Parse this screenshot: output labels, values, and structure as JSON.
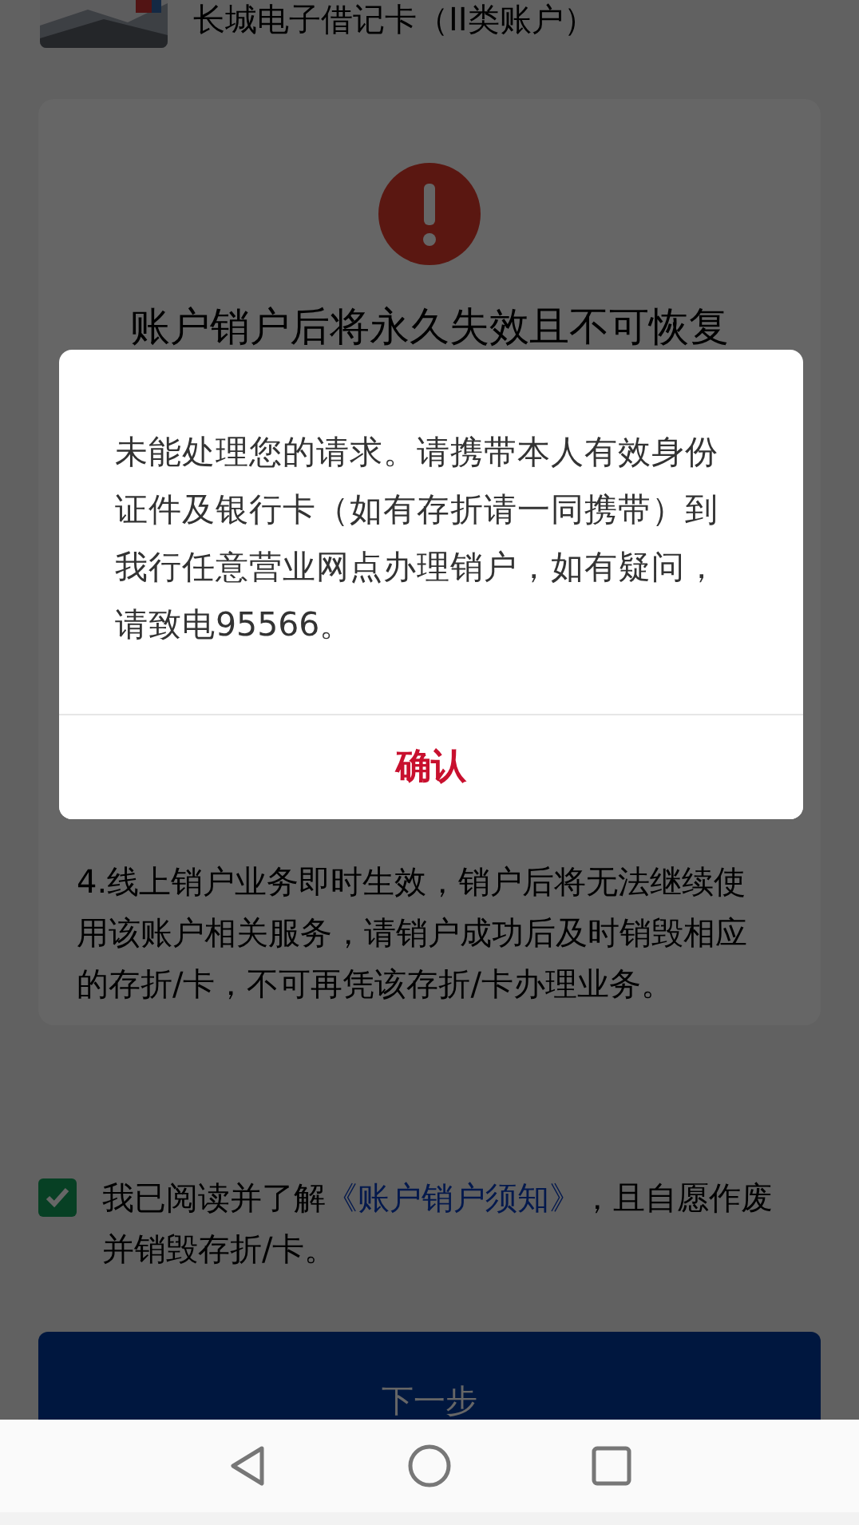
{
  "header": {
    "account_name": "长城电子借记卡（II类账户）"
  },
  "notice_card": {
    "title": "账户销户后将永久失效且不可恢复",
    "item": "4.线上销户业务即时生效，销户后将无法继续使用该账户相关服务，请销户成功后及时销毁相应的存折/卡，不可再凭该存折/卡办理业务。"
  },
  "agreement": {
    "checked": true,
    "text_before": "我已阅读并了解",
    "link": "《账户销户须知》",
    "text_after": "，且自愿作废并销毁存折/卡。"
  },
  "next_button": {
    "label": "下一步"
  },
  "dialog": {
    "message": "未能处理您的请求。请携带本人有效身份证件及银行卡（如有存折请一同携带）到我行任意营业网点办理销户，如有疑问，请致电95566。",
    "confirm": "确认"
  }
}
